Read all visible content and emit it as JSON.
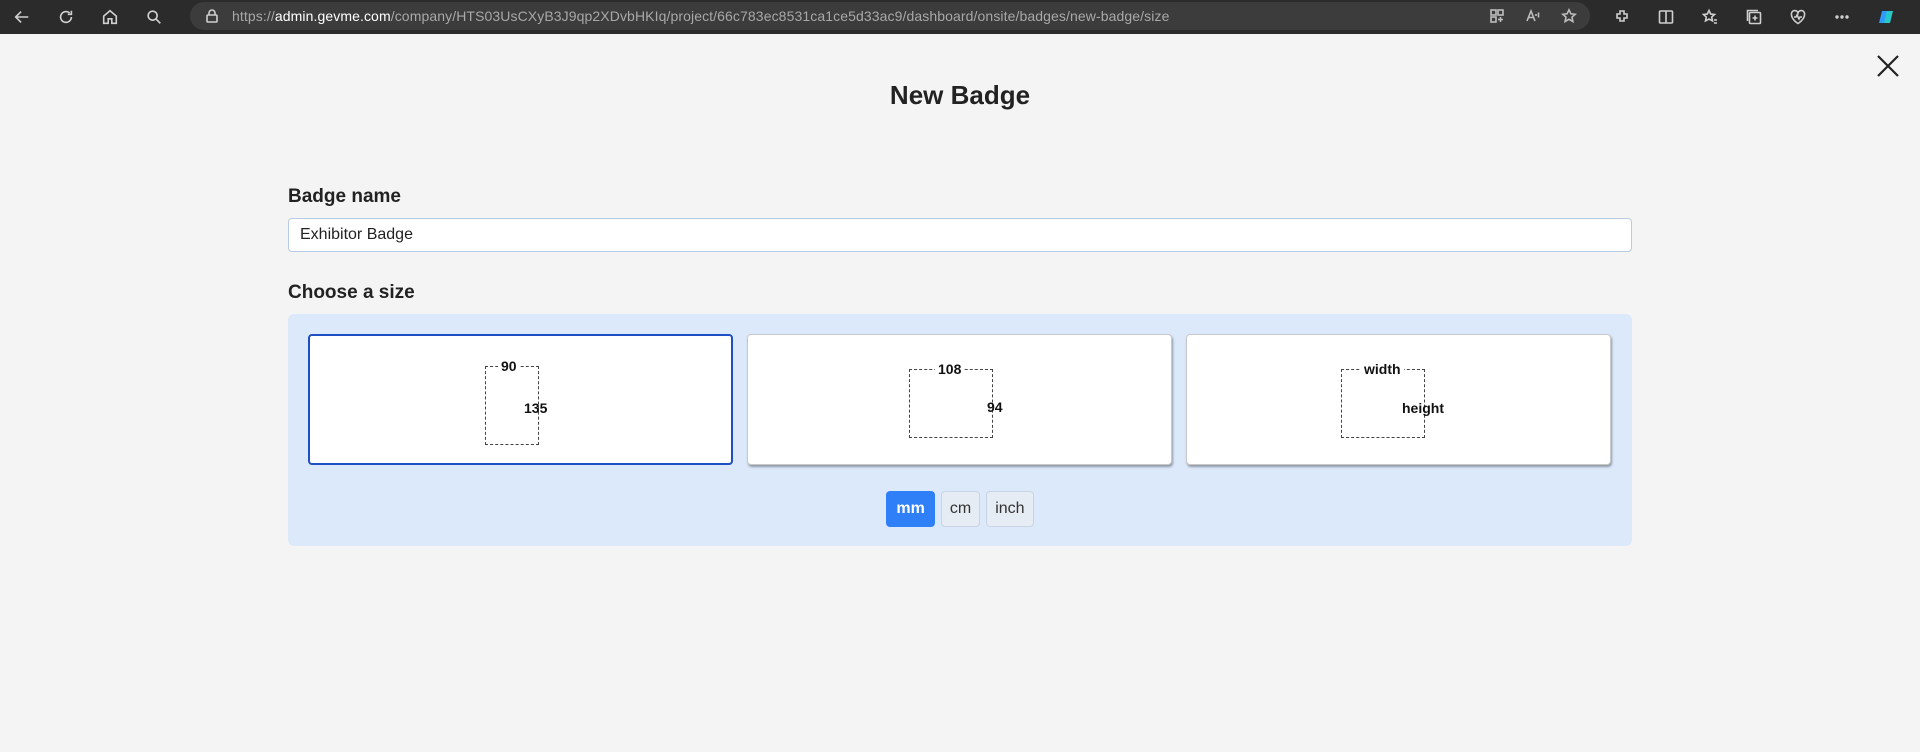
{
  "browser": {
    "url_prefix": "https://",
    "url_host": "admin.gevme.com",
    "url_path": "/company/HTS03UsCXyB3J9qp2XDvbHKIq/project/66c783ec8531ca1ce5d33ac9/dashboard/onsite/badges/new-badge/size"
  },
  "page": {
    "title": "New Badge",
    "badge_name_label": "Badge name",
    "badge_name_value": "Exhibitor Badge",
    "size_label": "Choose a size"
  },
  "sizes": [
    {
      "width": "90",
      "height": "135",
      "selected": true
    },
    {
      "width": "108",
      "height": "94",
      "selected": false
    },
    {
      "width": "width",
      "height": "height",
      "selected": false
    }
  ],
  "units": {
    "options": [
      "mm",
      "cm",
      "inch"
    ],
    "selected": "mm"
  },
  "colors": {
    "accent": "#2f7ff6",
    "selected_border": "#1f4fc4",
    "panel_bg": "#dce9fb"
  }
}
